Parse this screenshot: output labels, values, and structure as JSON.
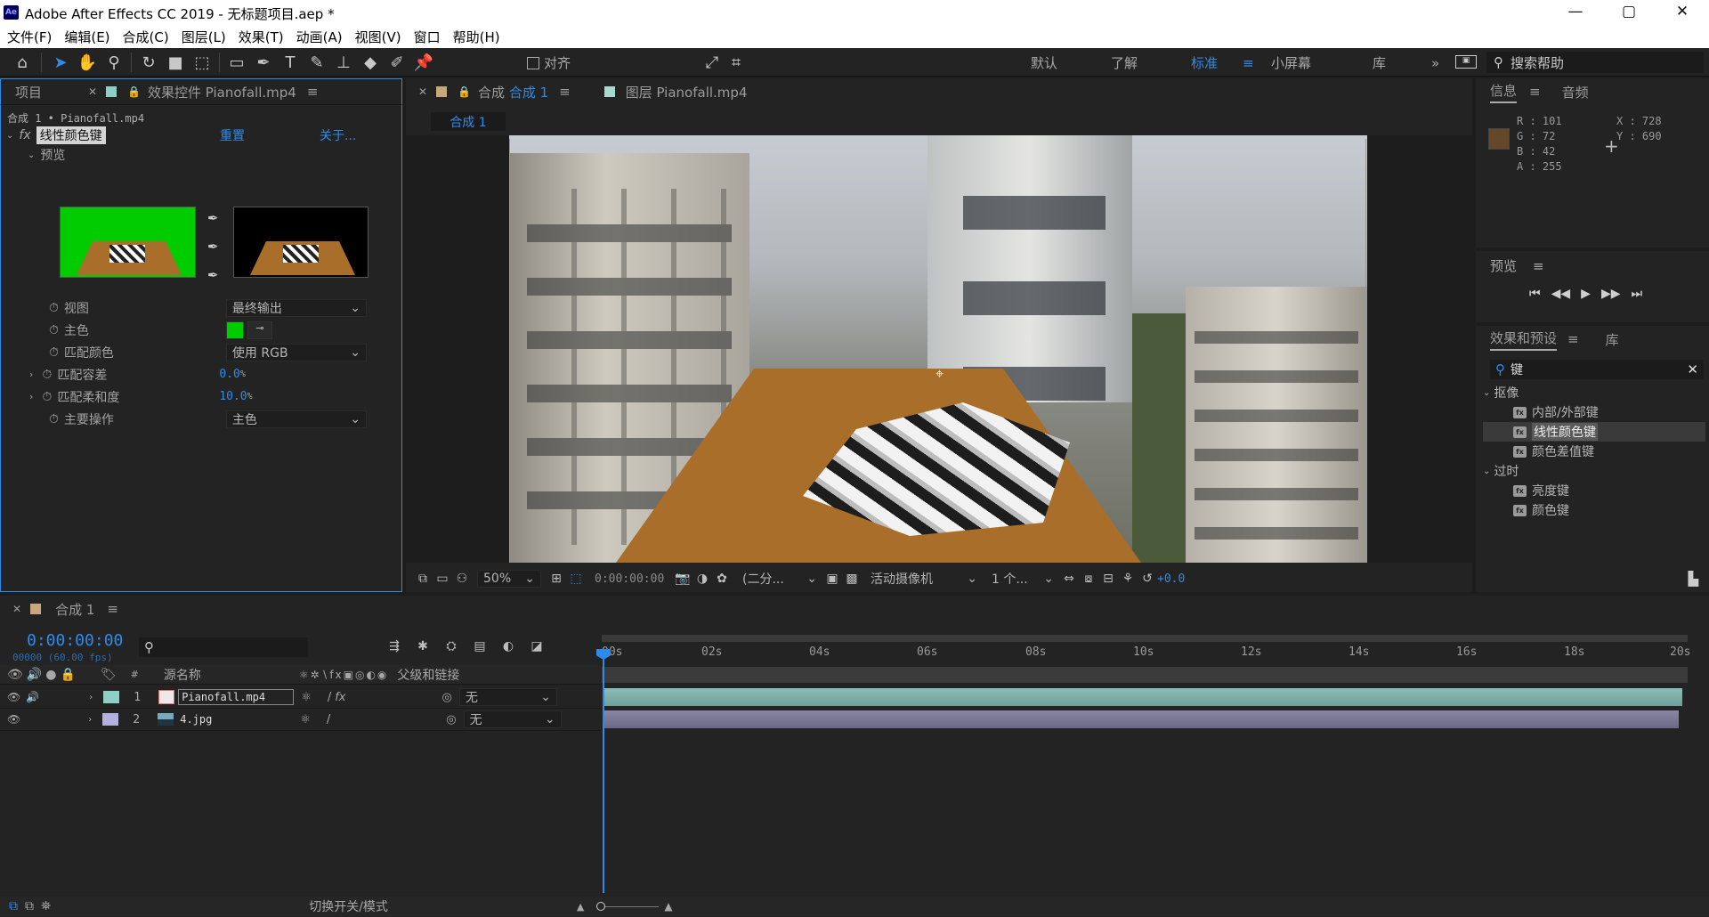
{
  "window": {
    "title": "Adobe After Effects CC 2019 - 无标题项目.aep *",
    "logo": "Ae"
  },
  "menu": [
    "文件(F)",
    "编辑(E)",
    "合成(C)",
    "图层(L)",
    "效果(T)",
    "动画(A)",
    "视图(V)",
    "窗口",
    "帮助(H)"
  ],
  "toolbar": {
    "align_label": "对齐",
    "workspaces": [
      "默认",
      "了解",
      "标准",
      "小屏幕",
      "库"
    ],
    "active_workspace": "标准",
    "search_help": "搜索帮助"
  },
  "left_panel": {
    "tab_project": "项目",
    "tab_effects": "效果控件 Pianofall.mp4",
    "breadcrumb": "合成 1 • Pianofall.mp4",
    "effect_name": "线性颜色键",
    "reset": "重置",
    "about": "关于...",
    "preview_label": "预览",
    "properties": [
      {
        "name": "视图",
        "value": "最终输出",
        "type": "dropdown"
      },
      {
        "name": "主色",
        "value": "",
        "type": "color"
      },
      {
        "name": "匹配颜色",
        "value": "使用 RGB",
        "type": "dropdown"
      },
      {
        "name": "匹配容差",
        "value": "0.0",
        "unit": "%",
        "type": "number"
      },
      {
        "name": "匹配柔和度",
        "value": "10.0",
        "unit": "%",
        "type": "number"
      },
      {
        "name": "主要操作",
        "value": "主色",
        "type": "dropdown"
      }
    ],
    "key_color": "#00cc00"
  },
  "viewer": {
    "tab_comp": "合成",
    "tab_comp_name": "合成 1",
    "tab_layer": "图层 Pianofall.mp4",
    "sub_tab": "合成 1",
    "zoom": "50%",
    "timecode": "0:00:00:00",
    "resolution": "(二分...",
    "camera": "活动摄像机",
    "views": "1 个...",
    "exposure": "+0.0"
  },
  "info_panel": {
    "tab_info": "信息",
    "tab_audio": "音频",
    "r": "R : 101",
    "g": "G : 72",
    "b": "B : 42",
    "a": "A : 255",
    "x": "X : 728",
    "y": "Y : 690",
    "swatch": "#65482a"
  },
  "preview_panel": {
    "title": "预览"
  },
  "effects_panel": {
    "tab_effects": "效果和预设",
    "tab_library": "库",
    "search_value": "键",
    "groups": [
      {
        "name": "抠像",
        "items": [
          "内部/外部键",
          "线性颜色键",
          "颜色差值键"
        ]
      },
      {
        "name": "过时",
        "items": [
          "亮度键",
          "颜色键"
        ]
      }
    ],
    "selected_item": "线性颜色键"
  },
  "timeline": {
    "tab": "合成 1",
    "timecode": "0:00:00:00",
    "frames": "00000 (60.00 fps)",
    "col_source": "源名称",
    "col_parent": "父级和链接",
    "ticks": [
      "00s",
      "02s",
      "04s",
      "06s",
      "08s",
      "10s",
      "12s",
      "14s",
      "16s",
      "18s",
      "20s"
    ],
    "layers": [
      {
        "num": "1",
        "name": "Pianofall.mp4",
        "parent": "无",
        "label_color": "#8fcfc3",
        "bar_color": "#7fb8b0"
      },
      {
        "num": "2",
        "name": "4.jpg",
        "parent": "无",
        "label_color": "#b4b0dd",
        "bar_color": "#7d7a98"
      }
    ],
    "footer_toggle": "切换开关/模式"
  }
}
